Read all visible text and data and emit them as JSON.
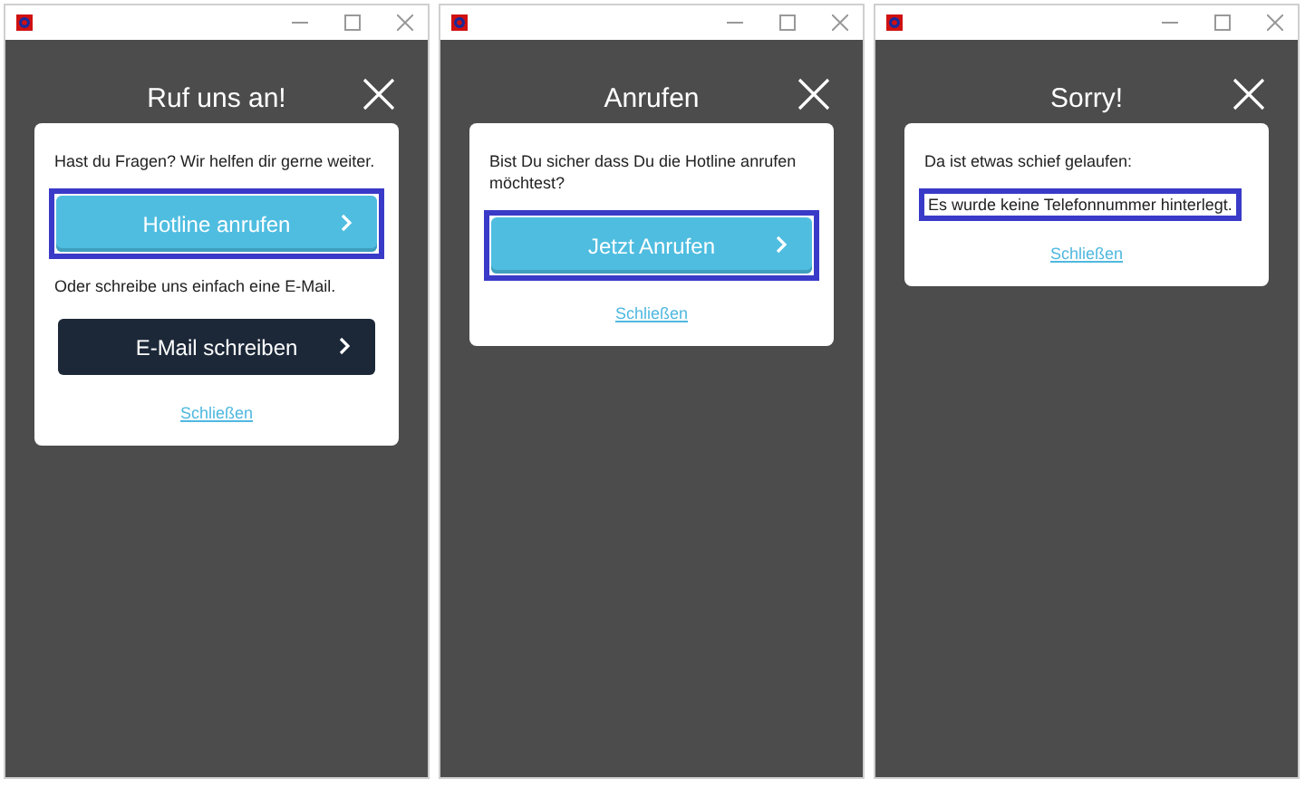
{
  "windows": [
    {
      "title": "Ruf uns an!",
      "items": [
        {
          "kind": "text",
          "text": "Hast du Fragen? Wir helfen dir gerne weiter.",
          "highlighted": false
        },
        {
          "kind": "primary",
          "text": "Hotline anrufen",
          "highlighted": true
        },
        {
          "kind": "text",
          "text": "Oder schreibe uns einfach eine E-Mail.",
          "highlighted": false
        },
        {
          "kind": "dark",
          "text": "E-Mail schreiben",
          "highlighted": false
        },
        {
          "kind": "link",
          "text": "Schließen",
          "highlighted": false
        }
      ]
    },
    {
      "title": "Anrufen",
      "items": [
        {
          "kind": "text",
          "text": "Bist Du sicher dass Du die Hotline anrufen möchtest?",
          "highlighted": false
        },
        {
          "kind": "primary",
          "text": "Jetzt Anrufen",
          "highlighted": true
        },
        {
          "kind": "link",
          "text": "Schließen",
          "highlighted": false
        }
      ]
    },
    {
      "title": "Sorry!",
      "items": [
        {
          "kind": "text",
          "text": "Da ist etwas schief gelaufen:",
          "highlighted": false
        },
        {
          "kind": "text",
          "text": "Es wurde keine Telefonnummer hinterlegt.",
          "highlighted": true
        },
        {
          "kind": "link",
          "text": "Schließen",
          "highlighted": false
        }
      ]
    }
  ]
}
